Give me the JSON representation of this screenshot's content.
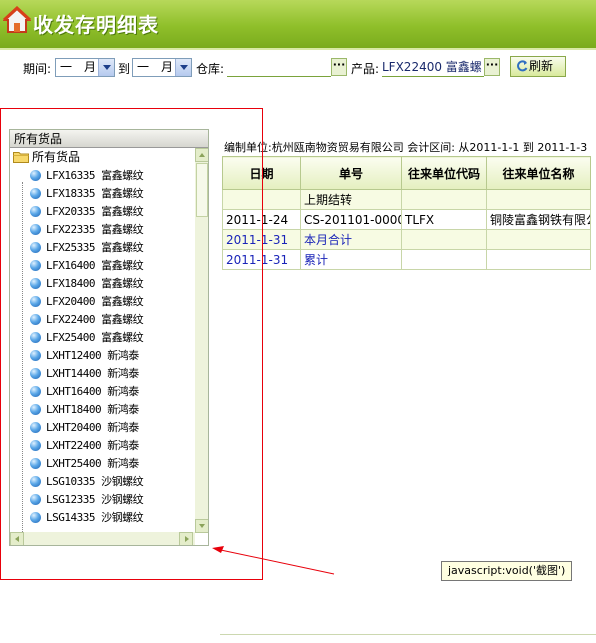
{
  "header": {
    "title": "收发存明细表",
    "icon": "home-icon",
    "color": "#8fbf2a"
  },
  "filters": {
    "period_label": "期间:",
    "period_from": "一　月",
    "to_label": "到",
    "period_to": "一　月",
    "warehouse_label": "仓库:",
    "warehouse_value": "",
    "product_label": "产品:",
    "product_value": "LFX22400 富鑫螺",
    "dots": "···",
    "refresh_label": "刷新"
  },
  "tree": {
    "header": "所有货品",
    "root": "所有货品",
    "items": [
      "LFX16335 富鑫螺纹",
      "LFX18335 富鑫螺纹",
      "LFX20335 富鑫螺纹",
      "LFX22335 富鑫螺纹",
      "LFX25335 富鑫螺纹",
      "LFX16400 富鑫螺纹",
      "LFX18400 富鑫螺纹",
      "LFX20400 富鑫螺纹",
      "LFX22400 富鑫螺纹",
      "LFX25400 富鑫螺纹",
      "LXHT12400 新鸿泰",
      "LXHT14400 新鸿泰",
      "LXHT16400 新鸿泰",
      "LXHT18400 新鸿泰",
      "LXHT20400 新鸿泰",
      "LXHT22400 新鸿泰",
      "LXHT25400 新鸿泰",
      "LSG10335 沙钢螺纹",
      "LSG12335 沙钢螺纹",
      "LSG14335 沙钢螺纹"
    ]
  },
  "report": {
    "info": "编制单位:杭州瓯南物资贸易有限公司  会计区间: 从2011-1-1 到  2011-1-3",
    "columns": [
      "日期",
      "单号",
      "往来单位代码",
      "往来单位名称"
    ],
    "rows": [
      [
        "",
        "上期结转",
        "",
        ""
      ],
      [
        "2011-1-24",
        "CS-201101-00006",
        "TLFX",
        "铜陵富鑫钢铁有限公"
      ],
      [
        "2011-1-31",
        "本月合计",
        "",
        ""
      ],
      [
        "2011-1-31",
        "累计",
        "",
        ""
      ]
    ]
  },
  "tooltip": "javascript:void('截图')",
  "annotation_color": "#e8000b"
}
